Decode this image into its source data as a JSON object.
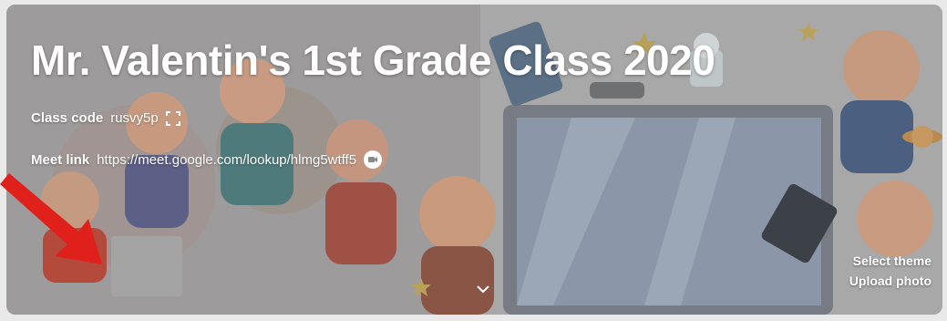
{
  "banner": {
    "title": "Mr. Valentin's 1st Grade Class 2020",
    "class_code_label": "Class code",
    "class_code": "rusvy5p",
    "meet_link_label": "Meet link",
    "meet_link": "https://meet.google.com/lookup/hlmg5wtff5",
    "select_theme": "Select theme",
    "upload_photo": "Upload photo",
    "icons": [
      "fullscreen-icon",
      "video-camera-icon",
      "chevron-down-icon"
    ]
  },
  "colors": {
    "overlay_text": "#ffffff",
    "annotation_arrow": "#e0201b"
  }
}
